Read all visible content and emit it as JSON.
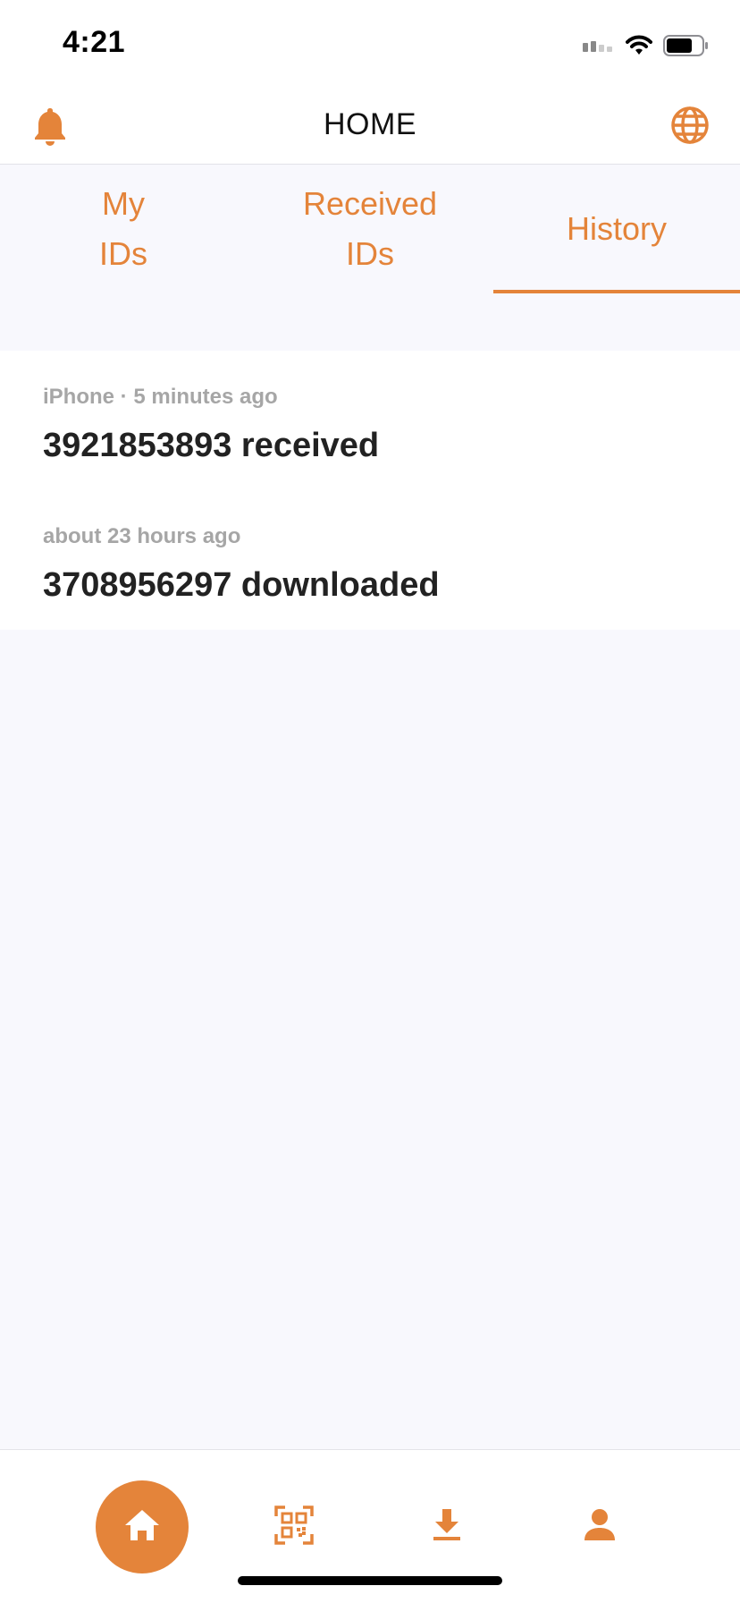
{
  "status_bar": {
    "time": "4:21",
    "icons": [
      "cellular-signal-icon",
      "wifi-icon",
      "battery-icon"
    ]
  },
  "header": {
    "title": "HOME",
    "left_icon": "bell-icon",
    "right_icon": "globe-icon"
  },
  "tabs": [
    {
      "line1": "My",
      "line2": "IDs",
      "active": false
    },
    {
      "line1": "Received",
      "line2": "IDs",
      "active": false
    },
    {
      "line1": "History",
      "line2": "",
      "active": true
    }
  ],
  "history": [
    {
      "meta": "iPhone · 5 minutes ago",
      "title": "3921853893 received"
    },
    {
      "meta": "about 23 hours ago",
      "title": "3708956297 downloaded"
    }
  ],
  "bottom_nav": [
    {
      "icon": "home-icon",
      "active": true
    },
    {
      "icon": "qr-code-icon",
      "active": false
    },
    {
      "icon": "download-icon",
      "active": false
    },
    {
      "icon": "profile-icon",
      "active": false
    }
  ],
  "colors": {
    "accent": "#e4843a",
    "background": "#f8f8fd",
    "surface": "#ffffff",
    "muted_text": "#a6a6a6",
    "primary_text": "#222222"
  }
}
